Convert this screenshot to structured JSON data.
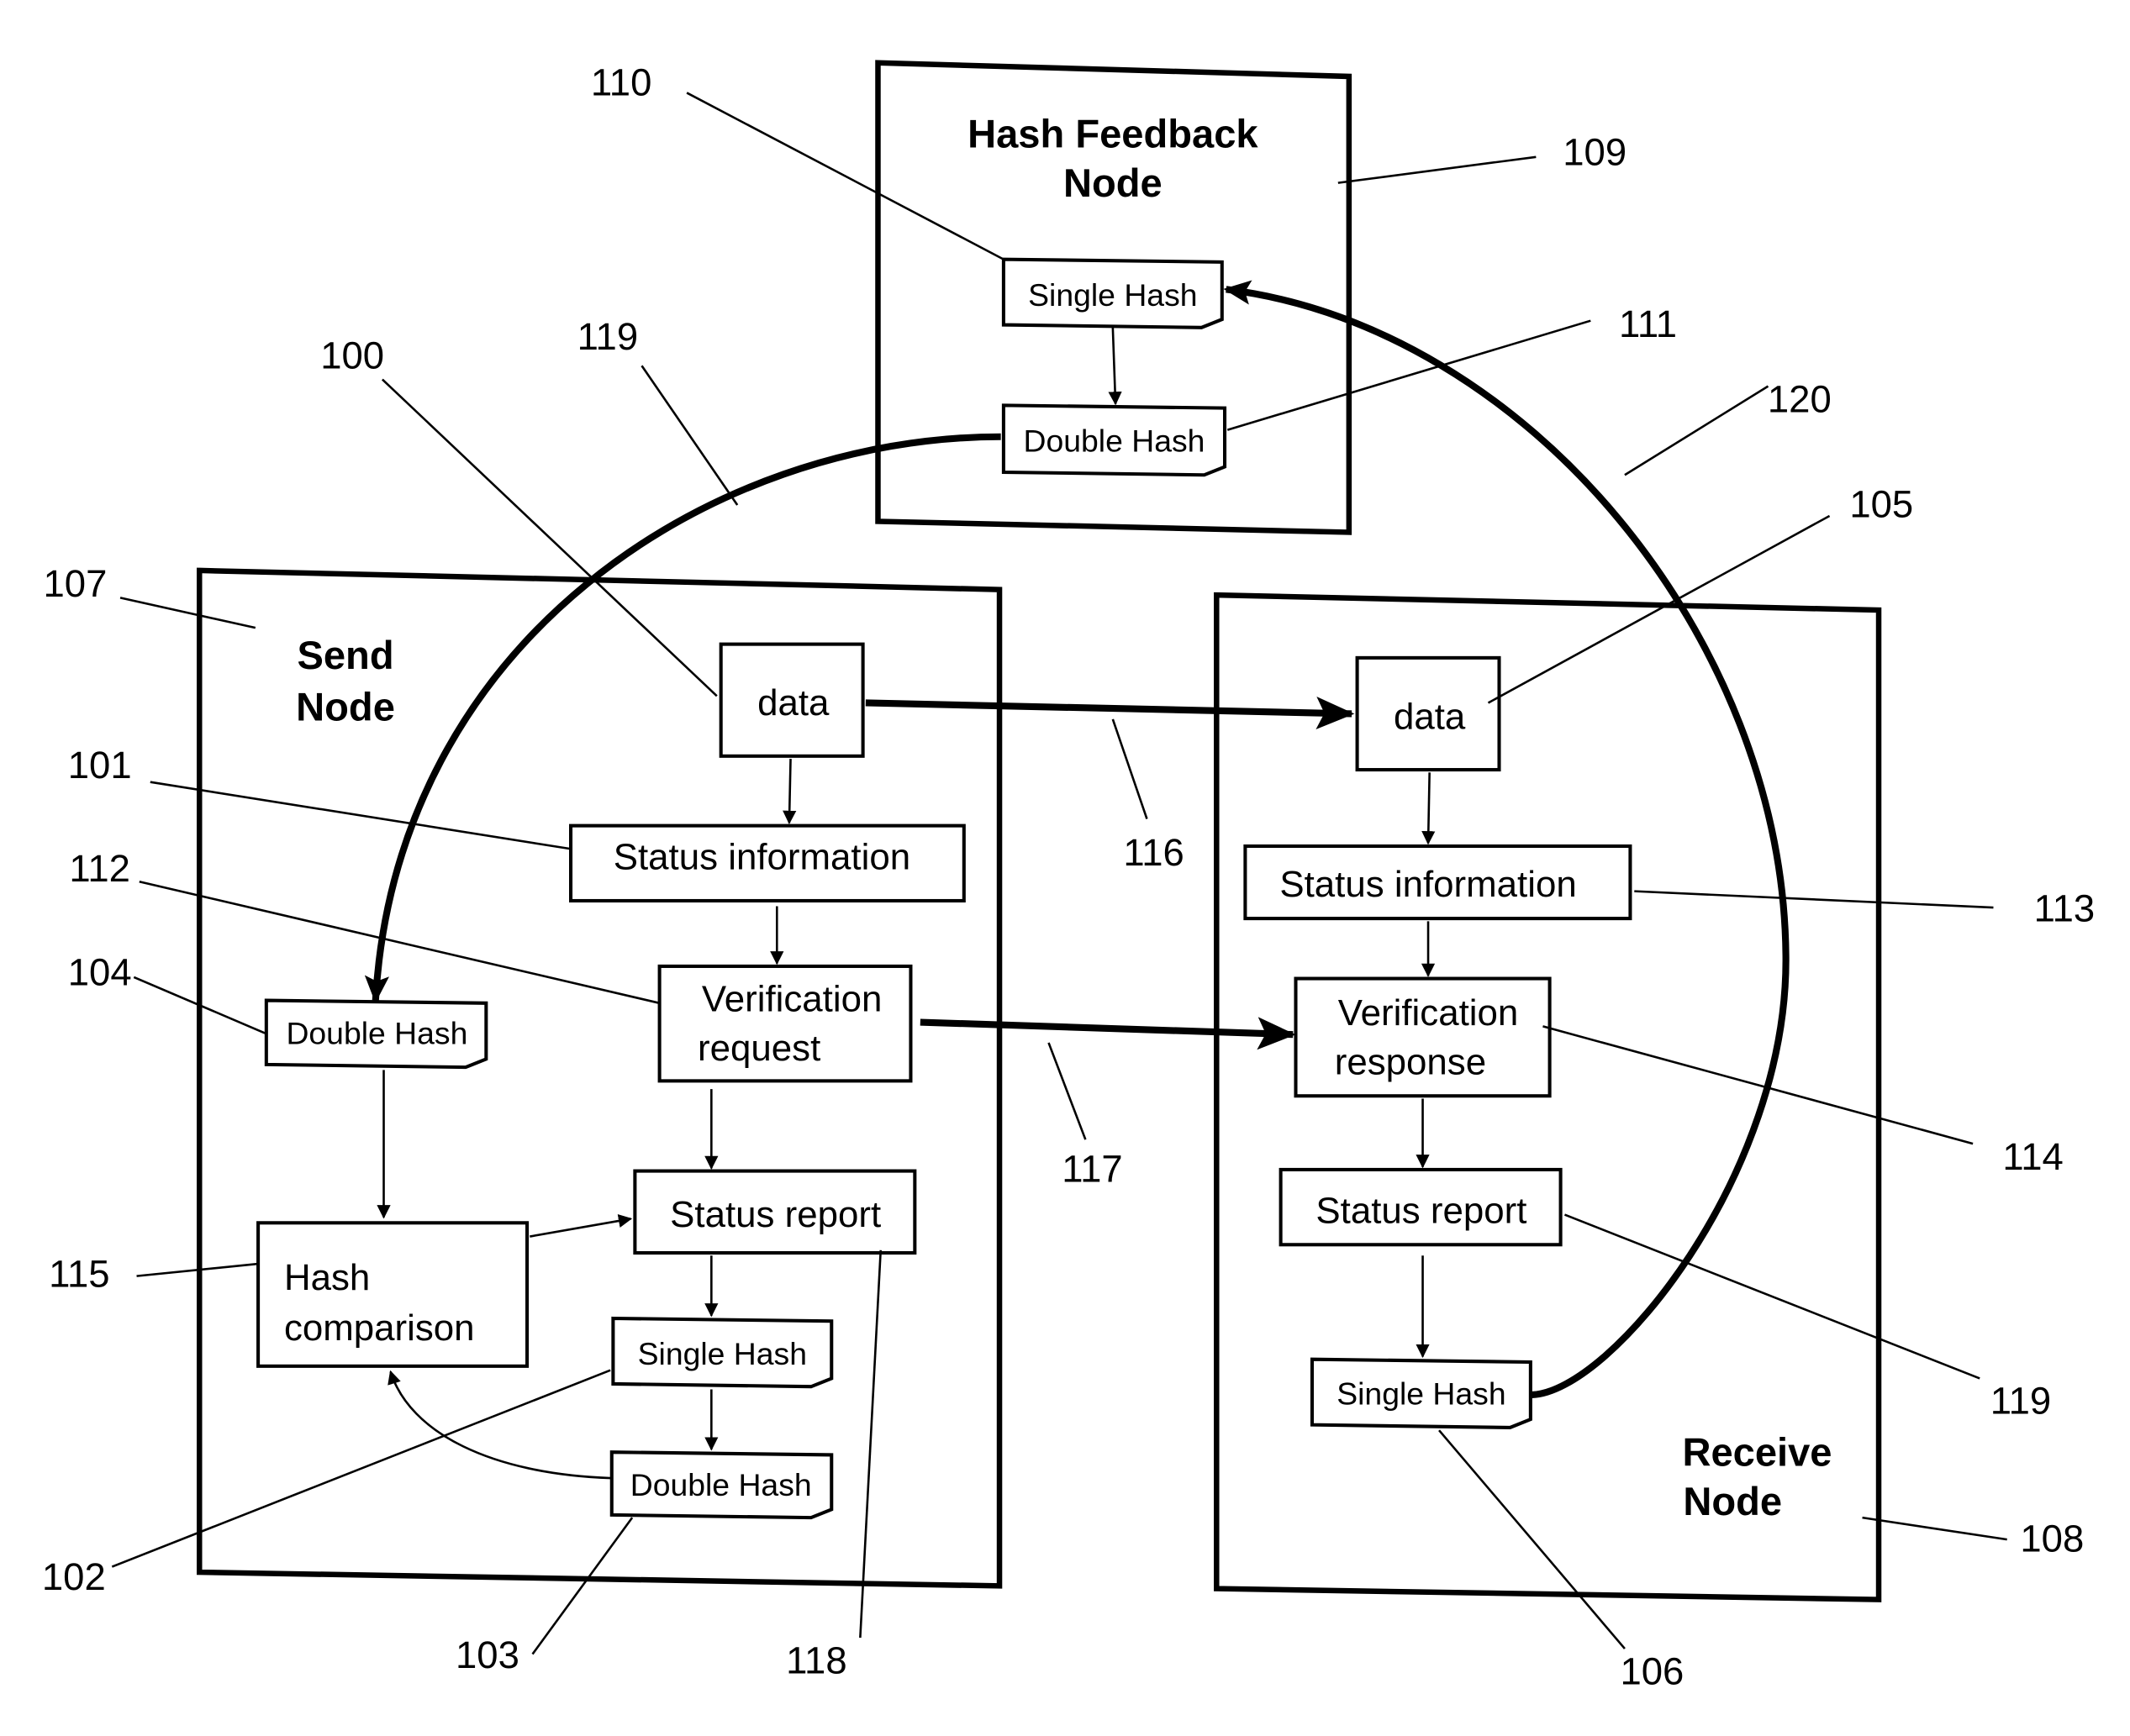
{
  "diagram": {
    "nodes": {
      "hash_feedback": {
        "title_line1": "Hash Feedback",
        "title_line2": "Node",
        "ref": "109"
      },
      "send": {
        "title_line1": "Send",
        "title_line2": "Node",
        "ref": "107"
      },
      "receive": {
        "title_line1": "Receive",
        "title_line2": "Node",
        "ref": "108"
      }
    },
    "blocks": {
      "hf_single_hash": {
        "label": "Single Hash",
        "ref": "110"
      },
      "hf_double_hash": {
        "label": "Double Hash",
        "ref": "111"
      },
      "send_data": {
        "label": "data",
        "ref": "100"
      },
      "send_status_info": {
        "label": "Status information",
        "ref": "101"
      },
      "send_verif_request": {
        "line1": "Verification",
        "line2": "request",
        "ref": "112"
      },
      "send_double_hash_recv": {
        "label": "Double Hash",
        "ref": "104"
      },
      "send_hash_comparison": {
        "line1": "Hash",
        "line2": "comparison",
        "ref": "115"
      },
      "send_status_report": {
        "label": "Status report",
        "ref": "118"
      },
      "send_single_hash": {
        "label": "Single Hash",
        "ref": "102"
      },
      "send_double_hash": {
        "label": "Double Hash",
        "ref": "103"
      },
      "recv_data": {
        "label": "data",
        "ref": "105"
      },
      "recv_status_info": {
        "label": "Status information",
        "ref": "113"
      },
      "recv_verif_response": {
        "line1": "Verification",
        "line2": "response",
        "ref": "114"
      },
      "recv_status_report": {
        "label": "Status report",
        "ref": "119"
      },
      "recv_single_hash": {
        "label": "Single Hash",
        "ref": "106"
      }
    },
    "connections": {
      "data_transfer": {
        "ref": "116"
      },
      "verification_transfer": {
        "ref": "117"
      },
      "double_hash_return": {
        "ref": "119"
      },
      "single_hash_feedback": {
        "ref": "120"
      }
    }
  }
}
